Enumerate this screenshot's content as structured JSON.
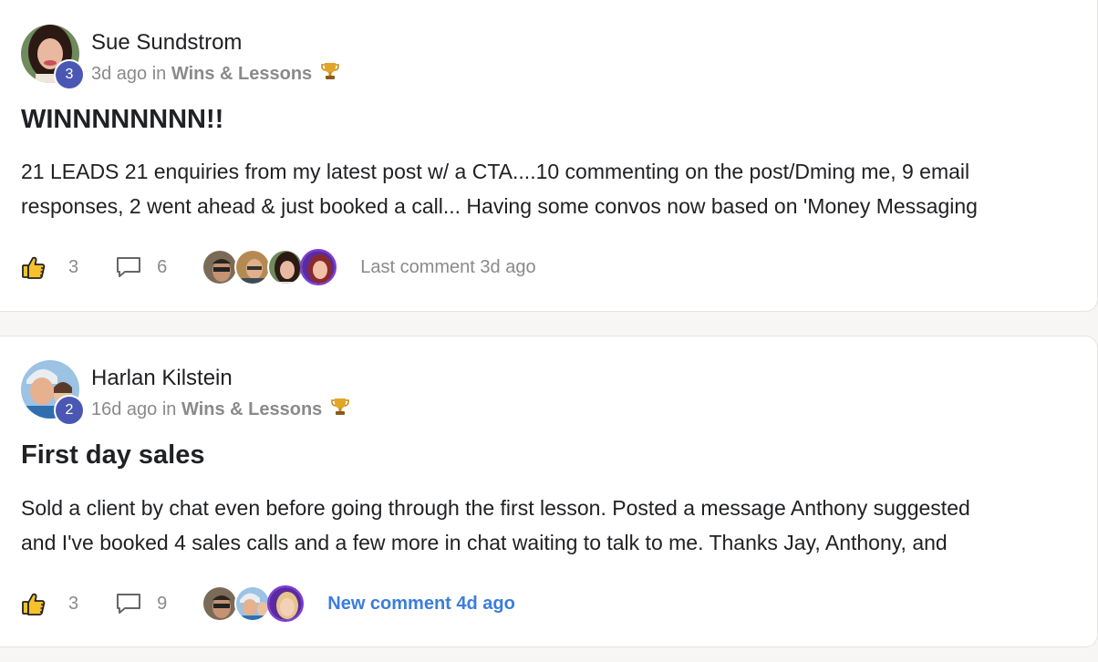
{
  "posts": [
    {
      "author": "Sue Sundstrom",
      "level": "3",
      "time": "3d ago",
      "in_word": "in",
      "category": "Wins & Lessons",
      "category_icon": "trophy-icon",
      "title": "WINNNNNNNN!!",
      "body_line1": "21 LEADS 21 enquiries from my latest post w/ a CTA....10 commenting on the post/Dming me, 9 email",
      "body_line2": "responses, 2 went ahead & just booked a call... Having some convos now based on 'Money Messaging",
      "likes": "3",
      "comments": "6",
      "comment_status": "Last comment 3d ago"
    },
    {
      "author": "Harlan Kilstein",
      "level": "2",
      "time": "16d ago",
      "in_word": "in",
      "category": "Wins & Lessons",
      "category_icon": "trophy-icon",
      "title": "First day sales",
      "body_line1": "Sold a client by chat even before going through the first lesson. Posted a message Anthony suggested",
      "body_line2": "and I've booked 4 sales calls and a few more in chat waiting to talk to me. Thanks Jay, Anthony, and",
      "likes": "3",
      "comments": "9",
      "comment_status": "New comment 4d ago"
    }
  ],
  "colors": {
    "level_badge": "#4a58b3",
    "new_comment": "#3b7ddd",
    "muted_text": "#8a8a8a"
  }
}
